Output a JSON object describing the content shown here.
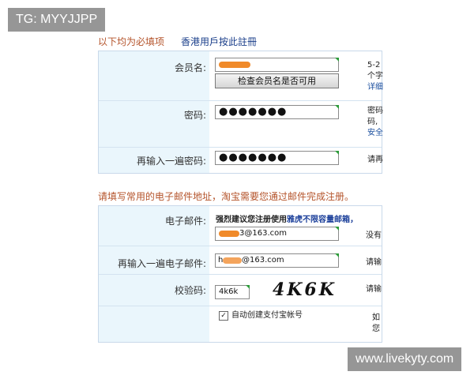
{
  "watermark": {
    "top": "TG: MYYJJPP",
    "bottom": "www.livekyty.com"
  },
  "header": {
    "required_note": "以下均为必填项",
    "hk_link": "香港用戶按此註冊"
  },
  "account": {
    "username_label": "会员名:",
    "check_button": "检查会员名是否可用",
    "username_hint_1": "5-2",
    "username_hint_2": "个字",
    "username_hint_3": "详细",
    "password_label": "密码:",
    "password_value": "●●●●●●●",
    "password_hint_1": "密码",
    "password_hint_2": "码,",
    "password_hint_3": "安全",
    "confirm_label": "再输入一遍密码:",
    "confirm_value": "●●●●●●●",
    "confirm_hint": "请再"
  },
  "email_section": {
    "title": "请填写常用的电子邮件地址，淘宝需要您通过邮件完成注册。",
    "email_label": "电子邮件:",
    "tip_prefix": "强烈建议您注册使用",
    "tip_emphasis": "雅虎不限容量邮箱，",
    "email_value": "3@163.com",
    "email_hint": "没有",
    "confirm_email_label": "再输入一遍电子邮件:",
    "confirm_email_value": "@163.com",
    "confirm_email_prefix": "h",
    "confirm_email_hint": "请输",
    "captcha_label": "校验码:",
    "captcha_value": "4k6k",
    "captcha_image_text": "4K6K",
    "captcha_hint": "请输",
    "alipay_checked": true,
    "alipay_label": "自动创建支付宝帐号",
    "alipay_hint_1": "如",
    "alipay_hint_2": "您"
  },
  "colors": {
    "label_bg": "#eaf6fc",
    "accent_orange": "#b4532a",
    "link_blue": "#1a3e8a",
    "input_corner": "#2d9b3a",
    "redaction": "#f08a2a"
  }
}
